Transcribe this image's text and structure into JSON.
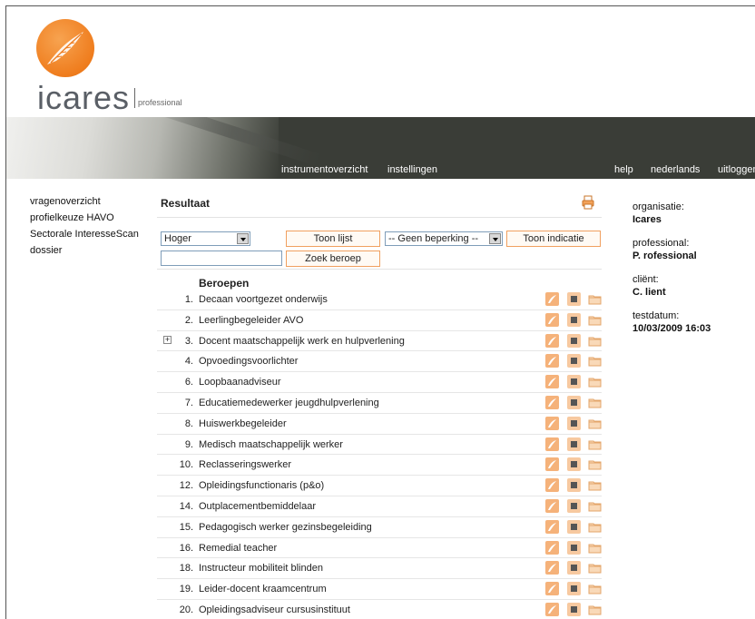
{
  "brand": {
    "name": "icares",
    "sub": "professional"
  },
  "colors": {
    "accent": "#ef7d1e",
    "banner": "#3a3d37"
  },
  "nav": {
    "instruments": "instrumentoverzicht",
    "settings": "instellingen",
    "help": "help",
    "language": "nederlands",
    "logout": "uitloggen"
  },
  "sidebar": {
    "items": [
      {
        "label": "vragenoverzicht"
      },
      {
        "label": "profielkeuze HAVO"
      },
      {
        "label": "Sectorale InteresseScan"
      },
      {
        "label": "dossier"
      }
    ]
  },
  "main": {
    "title": "Resultaat",
    "print_icon": "print-icon",
    "level_select": "Hoger",
    "show_list": "Toon lijst",
    "limit_select": "-- Geen beperking --",
    "show_indication": "Toon indicatie",
    "search_value": "",
    "search_button": "Zoek beroep",
    "list_header": "Beroepen",
    "rows": [
      {
        "num": "1.",
        "name": "Decaan voortgezet onderwijs",
        "expand": false
      },
      {
        "num": "2.",
        "name": "Leerlingbegeleider AVO",
        "expand": false
      },
      {
        "num": "3.",
        "name": "Docent maatschappelijk werk en hulpverlening",
        "expand": true,
        "expand_symbol": "+"
      },
      {
        "num": "4.",
        "name": "Opvoedingsvoorlichter",
        "expand": false
      },
      {
        "num": "6.",
        "name": "Loopbaanadviseur",
        "expand": false
      },
      {
        "num": "7.",
        "name": "Educatiemedewerker jeugdhulpverlening",
        "expand": false
      },
      {
        "num": "8.",
        "name": "Huiswerkbegeleider",
        "expand": false
      },
      {
        "num": "9.",
        "name": "Medisch maatschappelijk werker",
        "expand": false
      },
      {
        "num": "10.",
        "name": "Reclasseringswerker",
        "expand": false
      },
      {
        "num": "12.",
        "name": "Opleidingsfunctionaris (p&o)",
        "expand": false
      },
      {
        "num": "14.",
        "name": "Outplacementbemiddelaar",
        "expand": false
      },
      {
        "num": "15.",
        "name": "Pedagogisch werker gezinsbegeleiding",
        "expand": false
      },
      {
        "num": "16.",
        "name": "Remedial teacher",
        "expand": false
      },
      {
        "num": "18.",
        "name": "Instructeur mobiliteit blinden",
        "expand": false
      },
      {
        "num": "19.",
        "name": "Leider-docent kraamcentrum",
        "expand": false
      },
      {
        "num": "20.",
        "name": "Opleidingsadviseur cursusinstituut",
        "expand": false
      }
    ],
    "row_icons": [
      "brand-icon",
      "square-icon",
      "folder-icon"
    ]
  },
  "info": {
    "org_label": "organisatie:",
    "org_value": "Icares",
    "prof_label": "professional:",
    "prof_value": "P. rofessional",
    "client_label": "cliënt:",
    "client_value": "C. lient",
    "date_label": "testdatum:",
    "date_value": "10/03/2009 16:03"
  }
}
